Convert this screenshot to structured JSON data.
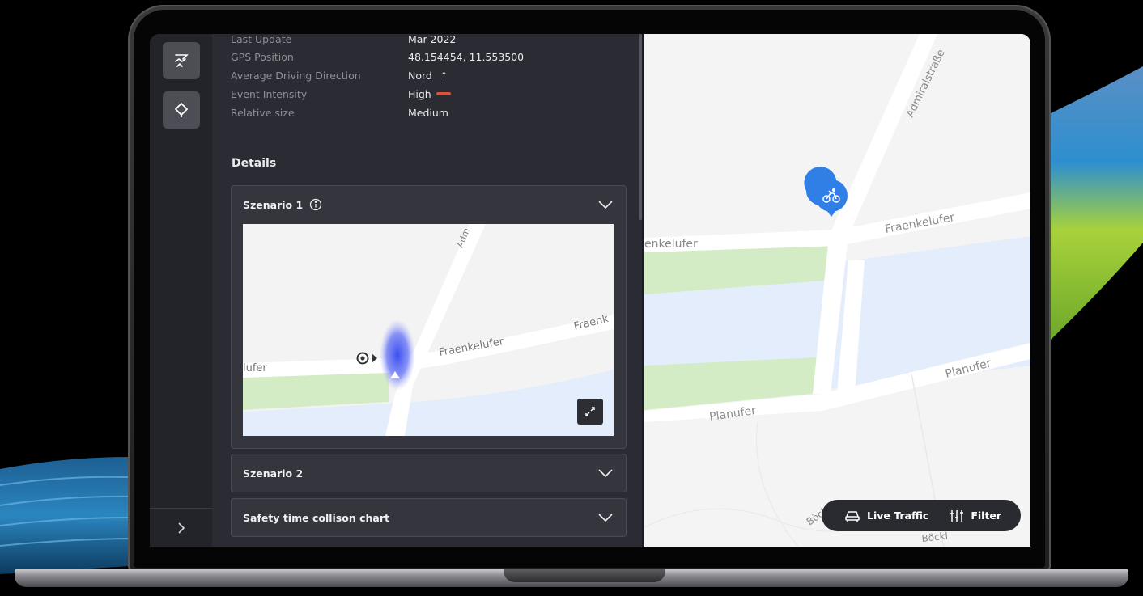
{
  "info": {
    "rows": [
      {
        "label": "Last Update",
        "value": "Mar 2022"
      },
      {
        "label": "GPS Position",
        "value": "48.154454, 11.553500"
      },
      {
        "label": "Average Driving Direction",
        "value": "Nord",
        "arrow": "↑"
      },
      {
        "label": "Event Intensity",
        "value": "High"
      },
      {
        "label": "Relative size",
        "value": "Medium"
      }
    ],
    "intensity_color": "#e0513a"
  },
  "details": {
    "title": "Details",
    "cards": [
      {
        "title": "Szenario 1",
        "expanded": true
      },
      {
        "title": "Szenario 2",
        "expanded": false
      },
      {
        "title": "Safety time collison  chart",
        "expanded": false
      }
    ]
  },
  "mini_map": {
    "labels": {
      "road_left": "lufer",
      "road_mid": "Fraenkelufer",
      "road_right": "Fraenk",
      "road_top": "Adm"
    }
  },
  "main_map": {
    "labels": {
      "admiral": "Admiralstraße",
      "fraenkel_right": "Fraenkelufer",
      "fraenkel_left": "enkelufer",
      "planufer_right": "Planufer",
      "planufer_left": "Planufer",
      "boeck_left": "Böck",
      "boeck_bottom": "Böckl"
    },
    "marker_color": "#2f7fe6"
  },
  "toolbar": {
    "live_traffic_label": "Live Traffic",
    "filter_label": "Filter"
  },
  "colors": {
    "panel_bg": "#2b2c33",
    "rail_bg": "#23242a",
    "water": "#e4edfb",
    "park": "#d4ecc6"
  }
}
